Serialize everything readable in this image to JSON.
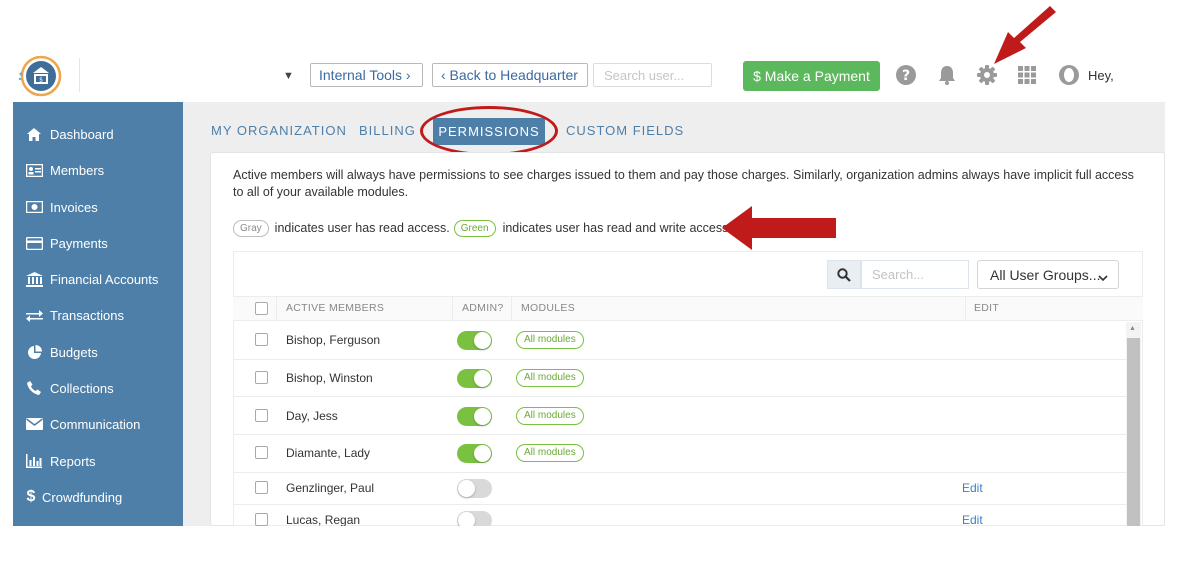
{
  "header": {
    "internal_tools": "Internal Tools ›",
    "back_to_hq": "‹ Back to Headquarter",
    "search_user_placeholder": "Search user...",
    "make_payment": "$ Make a Payment",
    "greeting": "Hey,"
  },
  "sidebar": {
    "items": [
      {
        "label": "Dashboard",
        "icon": "home-icon"
      },
      {
        "label": "Members",
        "icon": "id-card-icon"
      },
      {
        "label": "Invoices",
        "icon": "invoice-icon"
      },
      {
        "label": "Payments",
        "icon": "credit-card-icon"
      },
      {
        "label": "Financial Accounts",
        "icon": "bank-icon"
      },
      {
        "label": "Transactions",
        "icon": "exchange-icon"
      },
      {
        "label": "Budgets",
        "icon": "pie-chart-icon"
      },
      {
        "label": "Collections",
        "icon": "phone-icon"
      },
      {
        "label": "Communication",
        "icon": "envelope-icon"
      },
      {
        "label": "Reports",
        "icon": "bar-chart-icon"
      },
      {
        "label": "Crowdfunding",
        "icon": "dollar-icon"
      }
    ]
  },
  "tabs": {
    "my_organization": "MY ORGANIZATION",
    "billing": "BILLING",
    "permissions": "PERMISSIONS",
    "custom_fields": "CUSTOM FIELDS"
  },
  "permissions": {
    "description": "Active members will always have permissions to see charges issued to them and pay those charges. Similarly, organization admins always have implicit full access to all of your available modules.",
    "legend_gray": "Gray",
    "legend_gray_text": "indicates user has read access.",
    "legend_green": "Green",
    "legend_green_text": "indicates user has read and write access.",
    "search_placeholder": "Search...",
    "user_groups": "All User Groups...",
    "columns": {
      "members": "ACTIVE MEMBERS",
      "admin": "ADMIN?",
      "modules": "MODULES",
      "edit": "EDIT"
    },
    "rows": [
      {
        "name": "Bishop, Ferguson",
        "admin": true,
        "modules": "All modules",
        "edit": ""
      },
      {
        "name": "Bishop, Winston",
        "admin": true,
        "modules": "All modules",
        "edit": ""
      },
      {
        "name": "Day, Jess",
        "admin": true,
        "modules": "All modules",
        "edit": ""
      },
      {
        "name": "Diamante, Lady",
        "admin": true,
        "modules": "All modules",
        "edit": ""
      },
      {
        "name": "Genzlinger, Paul",
        "admin": false,
        "modules": "",
        "edit": "Edit"
      },
      {
        "name": "Lucas, Regan",
        "admin": false,
        "modules": "",
        "edit": "Edit"
      }
    ]
  },
  "colors": {
    "accent": "#4e7fa8",
    "green": "#7ac142",
    "annotation": "#c01b1b"
  }
}
